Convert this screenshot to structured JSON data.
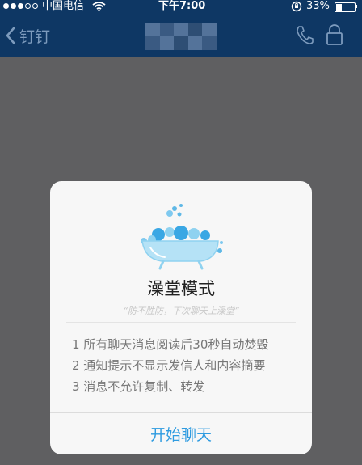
{
  "status_bar": {
    "carrier": "中国电信",
    "time": "下午7:00",
    "battery_percent": "33%",
    "battery_level": 0.33,
    "signal_bars_filled": 3,
    "signal_bars_total": 5
  },
  "nav": {
    "back_label": "钉钉",
    "title_obscured": true,
    "icons": [
      "chevron-left-icon",
      "phone-icon",
      "lock-icon"
    ]
  },
  "dialog": {
    "illustration": "bathtub-icon",
    "title": "澡堂模式",
    "slogan": "“防不胜防，下次聊天上澡堂”",
    "rules": [
      "1 所有聊天消息阅读后30秒自动焚毁",
      "2 通知提示不显示发信人和内容摘要",
      "3 消息不允许复制、转发"
    ],
    "button_label": "开始聊天"
  },
  "colors": {
    "header_bg": "#0e3764",
    "overlay_bg": "#5f5f61",
    "accent": "#2e9be0",
    "bathtub": "#8fd2f0"
  }
}
